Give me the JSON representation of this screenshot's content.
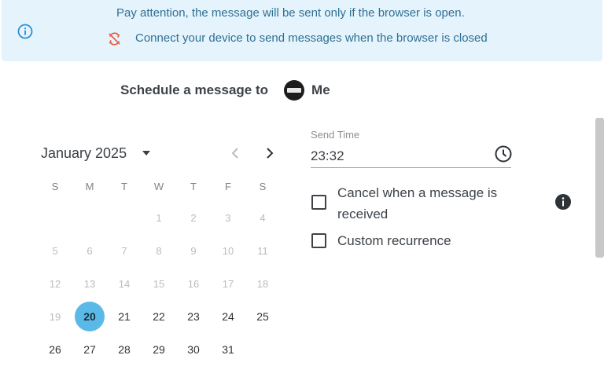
{
  "banner": {
    "line1": "Pay attention, the message will be sent only if the browser is open.",
    "line2": "Connect your device to send messages when the browser is closed",
    "info_icon": "info-circle-icon",
    "sync_icon": "sync-disabled-icon",
    "accent_color": "#2f6f93",
    "background_color": "#e5f4fc"
  },
  "schedule": {
    "label": "Schedule a message to",
    "recipient": "Me"
  },
  "calendar": {
    "month_label": "January 2025",
    "weekdays": [
      "S",
      "M",
      "T",
      "W",
      "T",
      "F",
      "S"
    ],
    "weeks": [
      [
        null,
        null,
        null,
        "1",
        "2",
        "3",
        "4"
      ],
      [
        "5",
        "6",
        "7",
        "8",
        "9",
        "10",
        "11"
      ],
      [
        "12",
        "13",
        "14",
        "15",
        "16",
        "17",
        "18"
      ],
      [
        "19",
        "20",
        "21",
        "22",
        "23",
        "24",
        "25"
      ],
      [
        "26",
        "27",
        "28",
        "29",
        "30",
        "31",
        null
      ]
    ],
    "selected_day": "20",
    "first_enabled_day": 20,
    "selected_color": "#5bb9e8"
  },
  "send_time": {
    "label": "Send Time",
    "value": "23:32"
  },
  "options": {
    "cancel_label": "Cancel when a message is received",
    "recurrence_label": "Custom recurrence",
    "cancel_checked": false,
    "recurrence_checked": false
  }
}
